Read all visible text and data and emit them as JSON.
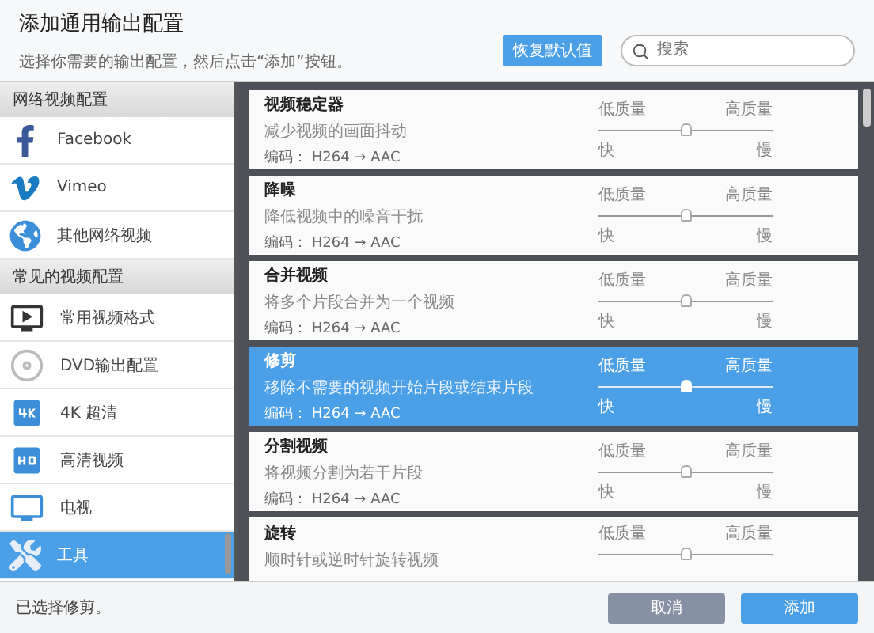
{
  "header": {
    "title": "添加通用输出配置",
    "subtitle": "选择你需要的输出配置，然后点击“添加”按钮。",
    "reset_button": "恢复默认值",
    "search": {
      "placeholder": "搜索"
    }
  },
  "sidebar": {
    "sections": [
      {
        "heading": "网络视频配置",
        "items": [
          {
            "label": "Facebook",
            "selected": false
          },
          {
            "label": "Vimeo",
            "selected": false
          },
          {
            "label": "其他网络视频",
            "selected": false
          }
        ]
      },
      {
        "heading": "常见的视频配置",
        "items": [
          {
            "label": "常用视频格式",
            "selected": false
          },
          {
            "label": "DVD输出配置",
            "selected": false
          },
          {
            "label": "4K 超清",
            "selected": false
          },
          {
            "label": "高清视频",
            "selected": false
          },
          {
            "label": "电视",
            "selected": false
          },
          {
            "label": "工具",
            "selected": true
          }
        ]
      }
    ]
  },
  "presets": [
    {
      "title": "视频稳定器",
      "description": "减少视频的画面抖动",
      "codec": "编码：  H264 → AAC",
      "low_label": "低质量",
      "high_label": "高质量",
      "level": 0.5,
      "fast_label": "快",
      "slow_label": "慢",
      "selected": false
    },
    {
      "title": "降噪",
      "description": "降低视频中的噪音干扰",
      "codec": "编码：  H264 → AAC",
      "low_label": "低质量",
      "high_label": "高质量",
      "level": 0.5,
      "fast_label": "快",
      "slow_label": "慢",
      "selected": false
    },
    {
      "title": "合并视频",
      "description": "将多个片段合并为一个视频",
      "codec": "编码：  H264 → AAC",
      "low_label": "低质量",
      "high_label": "高质量",
      "level": 0.5,
      "fast_label": "快",
      "slow_label": "慢",
      "selected": false
    },
    {
      "title": "修剪",
      "description": "移除不需要的视频开始片段或结束片段",
      "codec": "编码：  H264 → AAC",
      "low_label": "低质量",
      "high_label": "高质量",
      "level": 0.5,
      "fast_label": "快",
      "slow_label": "慢",
      "selected": true
    },
    {
      "title": "分割视频",
      "description": "将视频分割为若干片段",
      "codec": "编码：  H264 → AAC",
      "low_label": "低质量",
      "high_label": "高质量",
      "level": 0.5,
      "fast_label": "快",
      "slow_label": "慢",
      "selected": false
    },
    {
      "title": "旋转",
      "description": "顺时针或逆时针旋转视频",
      "low_label": "低质量",
      "high_label": "高质量",
      "level": 0.5,
      "selected": false
    }
  ],
  "footer": {
    "status": "已选择修剪。",
    "cancel_button": "取消",
    "add_button": "添加"
  }
}
